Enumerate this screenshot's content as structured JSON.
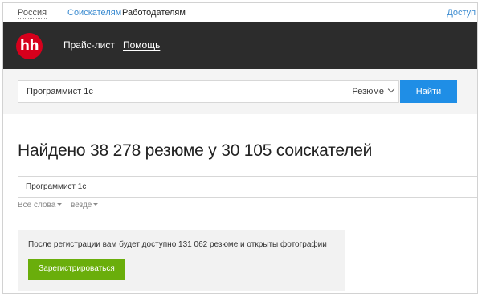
{
  "topnav": {
    "region": "Россия",
    "seekers": "Соискателям",
    "employers": "Работодателям",
    "access": "Доступ к"
  },
  "header": {
    "logo": "hh",
    "price_list": "Прайс-лист",
    "help": "Помощь"
  },
  "search": {
    "query": "Программист 1с",
    "type": "Резюме",
    "find": "Найти"
  },
  "results": {
    "title": "Найдено 38 278 резюме у 30 105 соискателей"
  },
  "refine": {
    "query": "Программист 1с",
    "filters": [
      {
        "label": "Все слова"
      },
      {
        "label": "везде"
      }
    ]
  },
  "promo": {
    "text": "После регистрации вам будет доступно 131 062 резюме и открыты фотографии",
    "register": "Зарегистрироваться"
  },
  "colors": {
    "brand_red": "#d6001c",
    "header_dark": "#2c2c2c",
    "link_blue": "#3b8bd0",
    "find_blue": "#1f8ee6",
    "register_green": "#6aae0b"
  }
}
